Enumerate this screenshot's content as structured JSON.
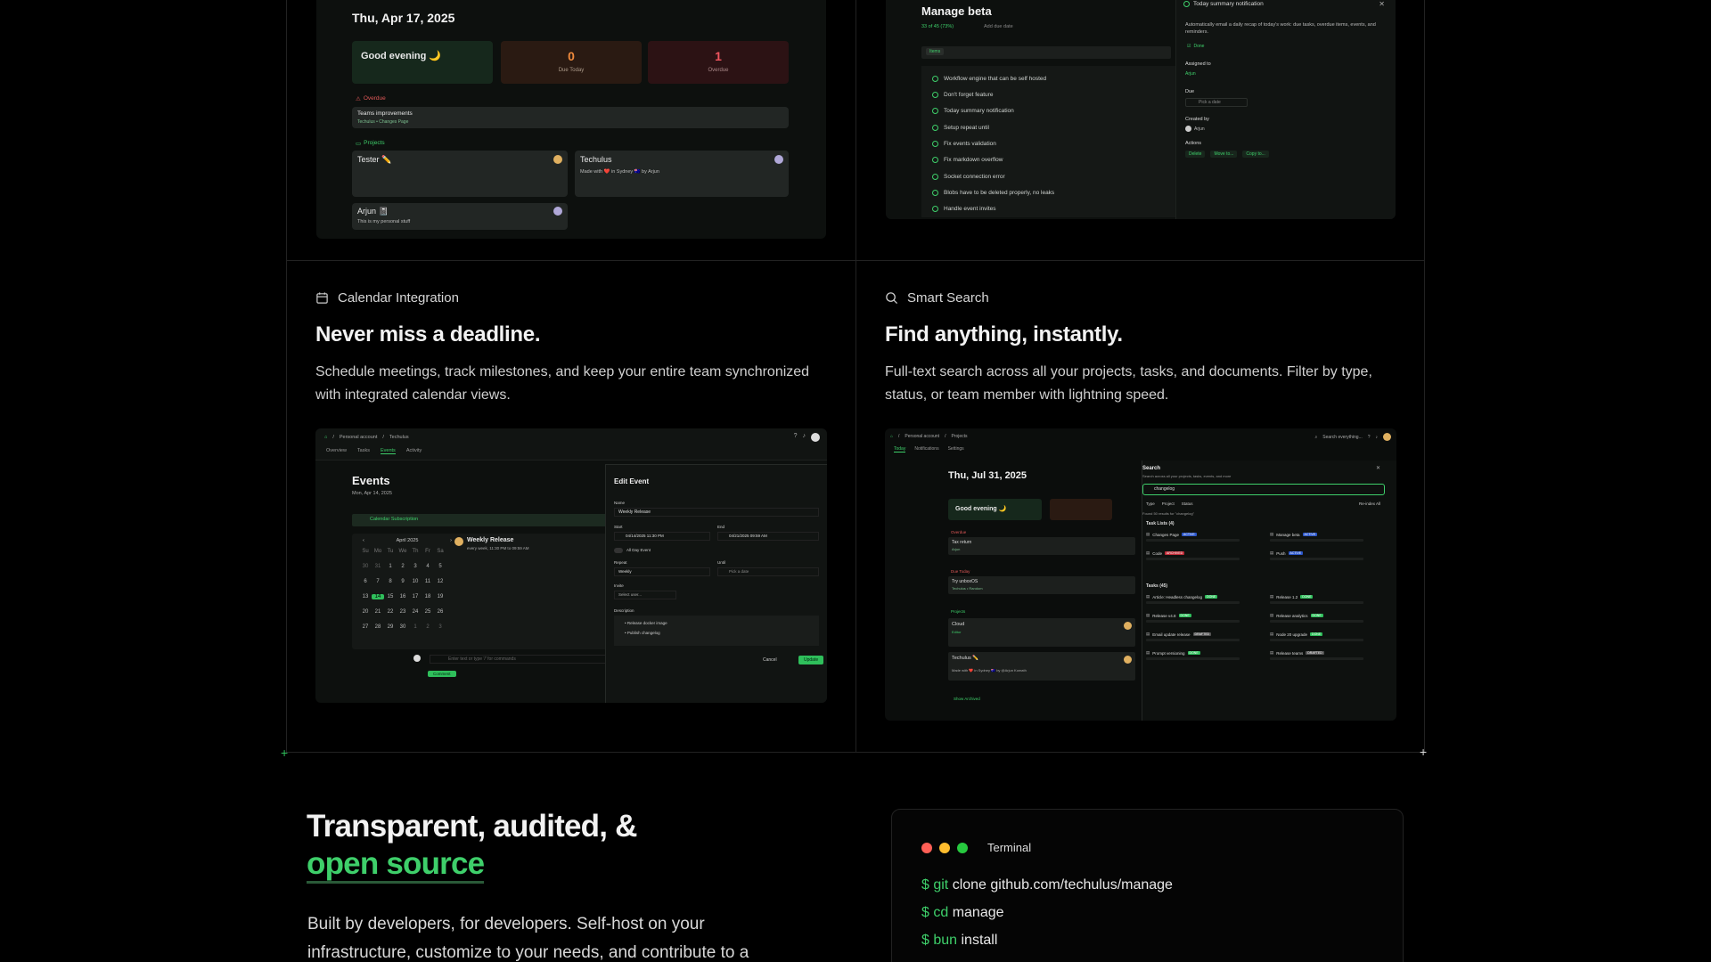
{
  "top_left_shot": {
    "date": "Thu, Apr 17, 2025",
    "greeting": "Good evening 🌙",
    "due_today": {
      "value": "0",
      "label": "Due Today"
    },
    "overdue": {
      "value": "1",
      "label": "Overdue"
    },
    "overdue_header": "Overdue",
    "overdue_item": {
      "title": "Teams improvements",
      "meta": "Techulus • Changes Page"
    },
    "projects_header": "Projects",
    "projects": [
      {
        "name": "Tester ✏️",
        "desc": ""
      },
      {
        "name": "Techulus",
        "desc": "Made with ❤️ in Sydney 🇦🇺 by Arjun"
      },
      {
        "name": "Arjun 📓",
        "desc": "This is my personal stuff"
      }
    ]
  },
  "top_right_shot": {
    "title": "Manage beta",
    "progress": "33 of 45 (73%)",
    "add_due": "Add due date",
    "tab": "Items",
    "tasks": [
      "Workflow engine that can be self hosted",
      "Don't forget feature",
      "Today summary notification",
      "Setup repeat until",
      "Fix events validation",
      "Fix markdown overflow",
      "Socket connection error",
      "Blobs have to be deleted properly, no leaks",
      "Handle event invites"
    ],
    "detail": {
      "title": "Today summary notification",
      "desc": "Automatically email a daily recap of today's work: due tasks, overdue items, events, and reminders.",
      "status": "Done",
      "assigned_label": "Assigned to",
      "assigned": "Arjun",
      "due_label": "Due",
      "due_placeholder": "Pick a date",
      "created_label": "Created by",
      "created": "Arjun",
      "actions_label": "Actions",
      "actions": [
        "Delete",
        "Move to...",
        "Copy to..."
      ]
    }
  },
  "features": [
    {
      "icon": "calendar-icon",
      "label": "Calendar Integration",
      "title": "Never miss a deadline.",
      "desc": "Schedule meetings, track milestones, and keep your entire team synchronized with integrated calendar views."
    },
    {
      "icon": "search-icon",
      "label": "Smart Search",
      "title": "Find anything, instantly.",
      "desc": "Full-text search across all your projects, tasks, and documents. Filter by type, status, or team member with lightning speed."
    }
  ],
  "calendar_shot": {
    "breadcrumb": [
      "Personal account",
      "Techulus"
    ],
    "tabs": [
      "Overview",
      "Tasks",
      "Events",
      "Activity"
    ],
    "active_tab": "Events",
    "title": "Events",
    "date": "Mon, Apr 14, 2025",
    "subscription": "Calendar Subscription",
    "month": "April 2025",
    "weekdays": [
      "Su",
      "Mo",
      "Tu",
      "We",
      "Th",
      "Fr",
      "Sa"
    ],
    "days": [
      "30",
      "31",
      "1",
      "2",
      "3",
      "4",
      "5",
      "6",
      "7",
      "8",
      "9",
      "10",
      "11",
      "12",
      "13",
      "14",
      "15",
      "16",
      "17",
      "18",
      "19",
      "20",
      "21",
      "22",
      "23",
      "24",
      "25",
      "26",
      "27",
      "28",
      "29",
      "30",
      "1",
      "2",
      "3"
    ],
    "today_index": 15,
    "event": {
      "title": "Weekly Release",
      "meta": "every week, 11:30 PM to 09:59 AM"
    },
    "comment_placeholder": "Enter text or type '/' for commands",
    "comment_button": "Comment",
    "edit": {
      "title": "Edit Event",
      "name_label": "Name",
      "name": "Weekly Release",
      "start_label": "Start",
      "start": "04/14/2025 11:30 PM",
      "end_label": "End",
      "end": "04/21/2025 09:59 AM",
      "all_day": "All Day Event",
      "repeat_label": "Repeat",
      "repeat": "Weekly",
      "until_label": "Until",
      "until": "Pick a date",
      "invite_label": "Invite",
      "invite": "Select user...",
      "desc_label": "Description",
      "desc_items": [
        "Release docker image",
        "Publish changelog"
      ],
      "cancel": "Cancel",
      "update": "Update"
    }
  },
  "search_shot": {
    "breadcrumb": [
      "Personal account",
      "Projects"
    ],
    "tabs": [
      "Today",
      "Notifications",
      "Settings"
    ],
    "search_bar": "Search everything...",
    "date": "Thu, Jul 31, 2025",
    "greeting": "Good evening 🌙",
    "overdue": "Overdue",
    "overdue_item": {
      "title": "Tax return",
      "meta": "Arjun"
    },
    "due_today": "Due Today",
    "due_item": {
      "title": "Try unboxOS",
      "meta": "Techulus • Random"
    },
    "projects": "Projects",
    "project_items": [
      {
        "name": "Cloud",
        "meta": "Editor"
      },
      {
        "name": "Techulus ✏️",
        "meta": "Made with ❤️ in Sydney 🇦🇺 by @Arjun Komath"
      }
    ],
    "show_archived": "Show Archived",
    "panel": {
      "title": "Search",
      "subtitle": "Search across all your projects, tasks, events, and more",
      "query": "changelog",
      "filters": [
        "Type",
        "Project",
        "Status"
      ],
      "reindex": "Re-index All",
      "found": "Found 50 results for \"changelog\"",
      "lists_header": "Task Lists (4)",
      "lists": [
        {
          "name": "Changes Page",
          "badge": "ACTIVE"
        },
        {
          "name": "Manage beta",
          "badge": "ACTIVE"
        },
        {
          "name": "Code",
          "badge": "ARCHIVED"
        },
        {
          "name": "Push",
          "badge": "ACTIVE"
        }
      ],
      "tasks_header": "Tasks (45)",
      "tasks": [
        {
          "name": "Article: Headless changelog",
          "badge": "DONE"
        },
        {
          "name": "Release 1.2",
          "badge": "DONE"
        },
        {
          "name": "Release v4.8",
          "badge": "DONE"
        },
        {
          "name": "Release analytics",
          "badge": "DONE"
        },
        {
          "name": "Email update release",
          "badge": "DRAFTED"
        },
        {
          "name": "Node 20 upgrade",
          "badge": "DONE"
        },
        {
          "name": "Prompt versioning",
          "badge": "DONE"
        },
        {
          "name": "Release teams",
          "badge": "DRAFTED"
        }
      ]
    }
  },
  "open_source": {
    "title_line1": "Transparent, audited, &",
    "title_line2": "open source",
    "desc": "Built by developers, for developers. Self-host on your infrastructure, customize to your needs, and contribute to a"
  },
  "terminal": {
    "title": "Terminal",
    "lines": [
      {
        "prompt": "$",
        "cmd": "git",
        "args": "clone github.com/techulus/manage"
      },
      {
        "prompt": "$",
        "cmd": "cd",
        "args": "manage"
      },
      {
        "prompt": "$",
        "cmd": "bun",
        "args": "install"
      }
    ]
  },
  "colors": {
    "accent": "#3ecf6a",
    "background": "#000000",
    "red": "#ff5f56",
    "yellow": "#ffbd2e",
    "green": "#27c93f"
  }
}
